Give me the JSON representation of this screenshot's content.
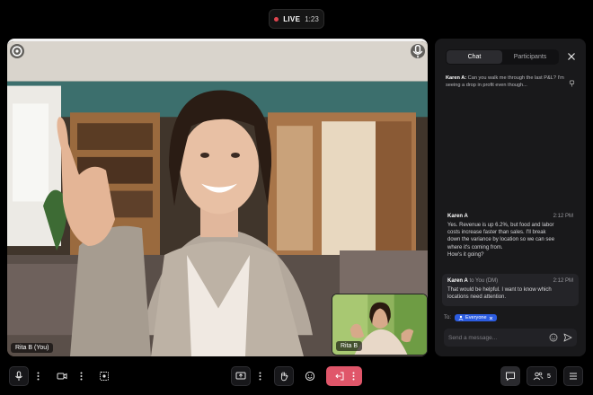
{
  "status": {
    "live_label": "LIVE",
    "elapsed": "1:23"
  },
  "stage": {
    "main_participant": "Rita B (You)",
    "pip_participant": "Rita B"
  },
  "panel": {
    "tabs": [
      {
        "label": "Chat",
        "active": true
      },
      {
        "label": "Participants",
        "active": false
      }
    ],
    "pinned": {
      "sender": "Karen A:",
      "text": "Can you walk me through the last P&L? I'm seeing a drop in profit even though..."
    },
    "messages": [
      {
        "sender": "Karen A",
        "recipient": "",
        "time": "2:12 PM",
        "lines": [
          "Yes. Revenue is up 6.2%, but food and labor",
          "costs increase faster than sales. I'll break",
          "down the variance by location so we can see",
          "where it's coming from."
        ],
        "extra": "How's it going?"
      },
      {
        "sender": "Karen A",
        "recipient": "to You (DM)",
        "time": "2:12 PM",
        "lines": [
          "That would be helpful. I want to know which",
          "locations need attention."
        ]
      }
    ],
    "to_label": "To:",
    "to_target": "Everyone",
    "compose_placeholder": "Send a message..."
  },
  "toolbar": {
    "participant_count": "5"
  },
  "colors": {
    "accent": "#2c5ce0",
    "leave": "#e0566a",
    "live": "#e0454f"
  },
  "icons": [
    "mic-icon",
    "camera-icon",
    "effects-icon",
    "share-screen-icon",
    "raise-hand-icon",
    "emoji-icon",
    "leave-icon",
    "chat-icon",
    "people-icon",
    "menu-icon",
    "more-icon",
    "pin-icon",
    "close-icon",
    "send-icon"
  ]
}
